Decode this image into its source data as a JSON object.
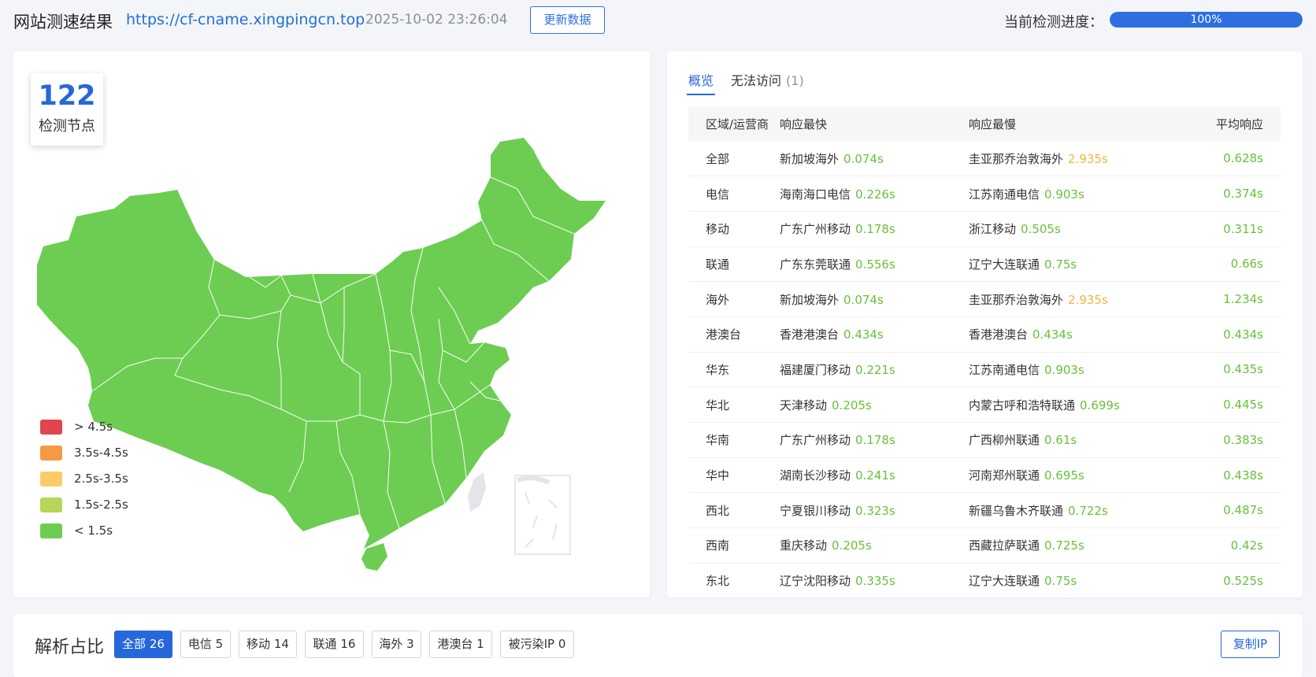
{
  "header": {
    "title": "网站测速结果",
    "url": "https://cf-cname.xingpingcn.top",
    "timestamp": "2025-10-02 23:26:04",
    "refresh_label": "更新数据",
    "progress_label": "当前检测进度：",
    "progress_value": 100,
    "progress_text": "100%"
  },
  "map": {
    "node_count": "122",
    "node_label": "检测节点",
    "region_color": "#6dcd52",
    "legend": [
      {
        "label": "> 4.5s",
        "color": "#e04550"
      },
      {
        "label": "3.5s-4.5s",
        "color": "#f79845"
      },
      {
        "label": "2.5s-3.5s",
        "color": "#fbcb67"
      },
      {
        "label": "1.5s-2.5s",
        "color": "#b5d75a"
      },
      {
        "label": "< 1.5s",
        "color": "#6dcd52"
      }
    ]
  },
  "tabs": [
    {
      "label": "概览",
      "active": true
    },
    {
      "label": "无法访问",
      "count": "(1)"
    }
  ],
  "table": {
    "headers": [
      "区域/运营商",
      "响应最快",
      "响应最慢",
      "平均响应"
    ],
    "rows": [
      {
        "region": "全部",
        "fast_name": "新加坡海外",
        "fast_time": "0.074s",
        "slow_name": "圭亚那乔治敦海外",
        "slow_time": "2.935s",
        "slow_warn": true,
        "avg": "0.628s"
      },
      {
        "region": "电信",
        "fast_name": "海南海口电信",
        "fast_time": "0.226s",
        "slow_name": "江苏南通电信",
        "slow_time": "0.903s",
        "slow_warn": false,
        "avg": "0.374s"
      },
      {
        "region": "移动",
        "fast_name": "广东广州移动",
        "fast_time": "0.178s",
        "slow_name": "浙江移动",
        "slow_time": "0.505s",
        "slow_warn": false,
        "avg": "0.311s"
      },
      {
        "region": "联通",
        "fast_name": "广东东莞联通",
        "fast_time": "0.556s",
        "slow_name": "辽宁大连联通",
        "slow_time": "0.75s",
        "slow_warn": false,
        "avg": "0.66s"
      },
      {
        "region": "海外",
        "fast_name": "新加坡海外",
        "fast_time": "0.074s",
        "slow_name": "圭亚那乔治敦海外",
        "slow_time": "2.935s",
        "slow_warn": true,
        "avg": "1.234s"
      },
      {
        "region": "港澳台",
        "fast_name": "香港港澳台",
        "fast_time": "0.434s",
        "slow_name": "香港港澳台",
        "slow_time": "0.434s",
        "slow_warn": false,
        "avg": "0.434s"
      },
      {
        "region": "华东",
        "fast_name": "福建厦门移动",
        "fast_time": "0.221s",
        "slow_name": "江苏南通电信",
        "slow_time": "0.903s",
        "slow_warn": false,
        "avg": "0.435s"
      },
      {
        "region": "华北",
        "fast_name": "天津移动",
        "fast_time": "0.205s",
        "slow_name": "内蒙古呼和浩特联通",
        "slow_time": "0.699s",
        "slow_warn": false,
        "avg": "0.445s"
      },
      {
        "region": "华南",
        "fast_name": "广东广州移动",
        "fast_time": "0.178s",
        "slow_name": "广西柳州联通",
        "slow_time": "0.61s",
        "slow_warn": false,
        "avg": "0.383s"
      },
      {
        "region": "华中",
        "fast_name": "湖南长沙移动",
        "fast_time": "0.241s",
        "slow_name": "河南郑州联通",
        "slow_time": "0.695s",
        "slow_warn": false,
        "avg": "0.438s"
      },
      {
        "region": "西北",
        "fast_name": "宁夏银川移动",
        "fast_time": "0.323s",
        "slow_name": "新疆乌鲁木齐联通",
        "slow_time": "0.722s",
        "slow_warn": false,
        "avg": "0.487s"
      },
      {
        "region": "西南",
        "fast_name": "重庆移动",
        "fast_time": "0.205s",
        "slow_name": "西藏拉萨联通",
        "slow_time": "0.725s",
        "slow_warn": false,
        "avg": "0.42s"
      },
      {
        "region": "东北",
        "fast_name": "辽宁沈阳移动",
        "fast_time": "0.335s",
        "slow_name": "辽宁大连联通",
        "slow_time": "0.75s",
        "slow_warn": false,
        "avg": "0.525s"
      }
    ]
  },
  "analysis": {
    "title": "解析占比",
    "filters": [
      {
        "label": "全部",
        "count": "26",
        "active": true
      },
      {
        "label": "电信",
        "count": "5"
      },
      {
        "label": "移动",
        "count": "14"
      },
      {
        "label": "联通",
        "count": "16"
      },
      {
        "label": "海外",
        "count": "3"
      },
      {
        "label": "港澳台",
        "count": "1"
      },
      {
        "label": "被污染IP",
        "count": "0"
      }
    ],
    "copy_label": "复制IP"
  }
}
